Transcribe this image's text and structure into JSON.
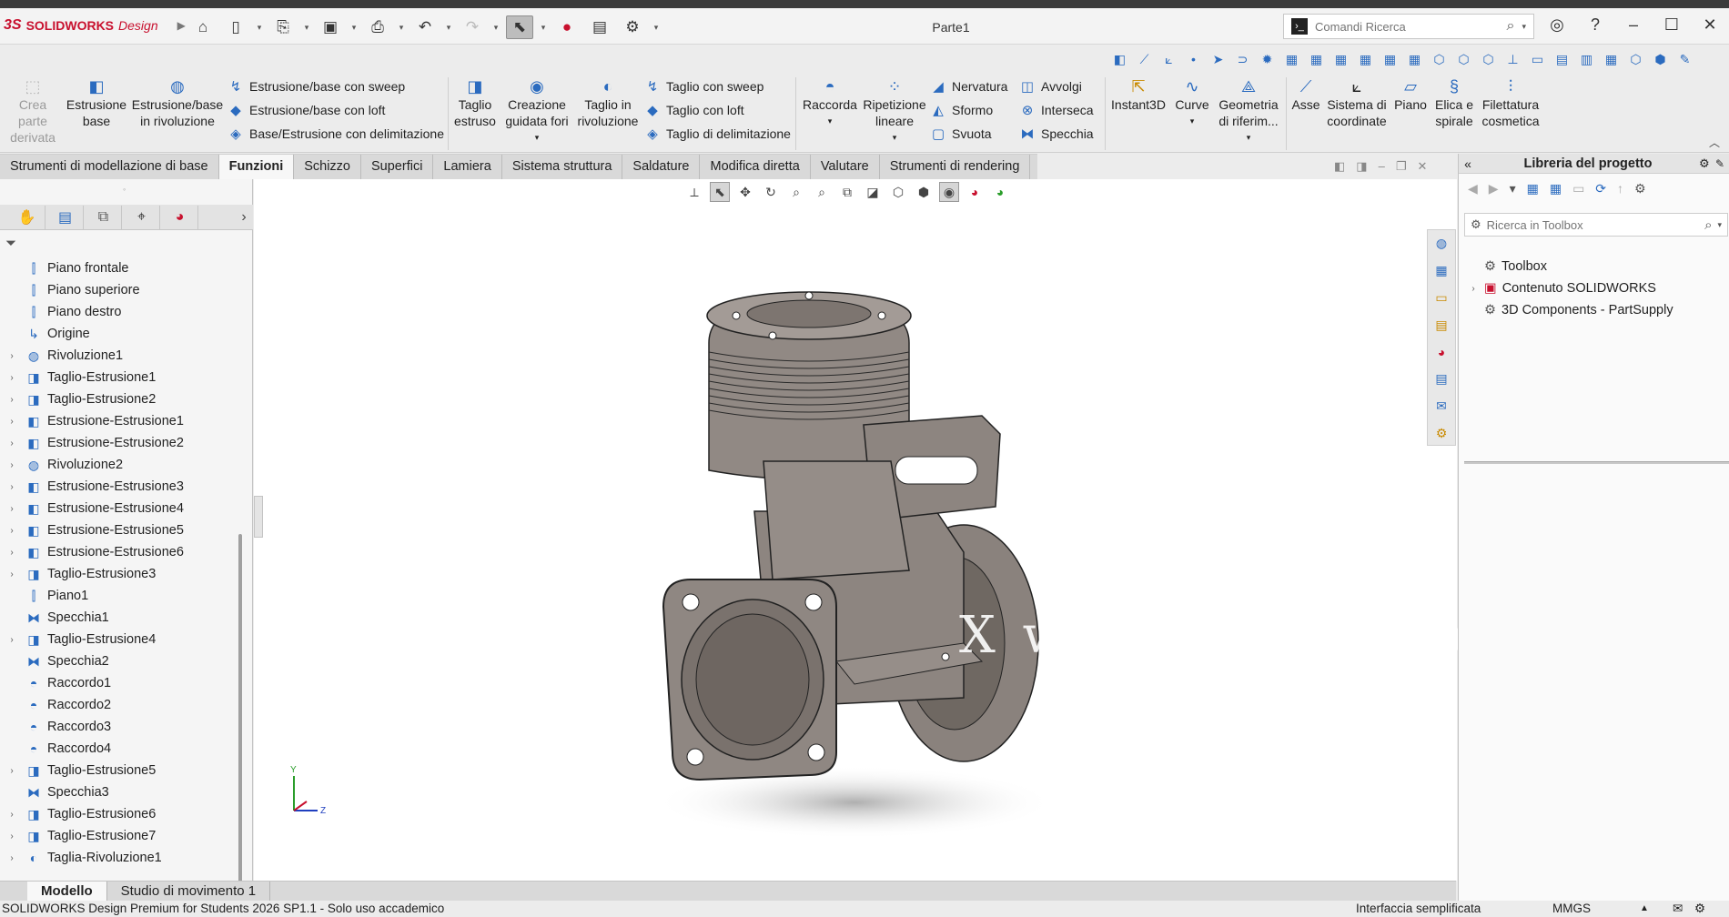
{
  "app": {
    "brand_ds": "3S",
    "brand_sw": "SOLIDWORKS",
    "brand_design": "Design",
    "doc_title": "Parte1"
  },
  "search": {
    "placeholder": "Comandi Ricerca"
  },
  "quick_access": [
    "home-icon",
    "new-icon",
    "open-icon",
    "save-icon",
    "print-icon",
    "undo-icon",
    "redo-icon",
    "select-icon",
    "rebuild-icon",
    "file-props-icon",
    "options-icon"
  ],
  "ribbon": {
    "crea_parte": "Crea\nparte\nderivata",
    "estrusione_base": "Estrusione\nbase",
    "rivoluzione_base": "Estrusione/base\nin rivoluzione",
    "sweep": "Estrusione/base con sweep",
    "loft": "Estrusione/base con loft",
    "delim": "Base/Estrusione con delimitazione",
    "taglio_estruso": "Taglio\nestruso",
    "guidata_fori": "Creazione\nguidata fori",
    "taglio_rivoluzione": "Taglio in\nrivoluzione",
    "taglio_sweep": "Taglio con sweep",
    "taglio_loft": "Taglio con loft",
    "taglio_delim": "Taglio di delimitazione",
    "raccorda": "Raccorda",
    "ripetizione": "Ripetizione\nlineare",
    "nervatura": "Nervatura",
    "sformo": "Sformo",
    "svuota": "Svuota",
    "avvolgi": "Avvolgi",
    "interseca": "Interseca",
    "specchia": "Specchia",
    "instant3d": "Instant3D",
    "curve": "Curve",
    "geometria": "Geometria\ndi riferim...",
    "asse": "Asse",
    "sistema": "Sistema di\ncoordinate",
    "piano": "Piano",
    "elica": "Elica e\nspirale",
    "filettatura": "Filettatura\ncosmetica"
  },
  "tabs": [
    "Strumenti di modellazione di base",
    "Funzioni",
    "Schizzo",
    "Superfici",
    "Lamiera",
    "Sistema struttura",
    "Saldature",
    "Modifica diretta",
    "Valutare",
    "Strumenti di rendering"
  ],
  "active_tab": "Funzioni",
  "tree": [
    {
      "label": "Piano frontale",
      "icon": "plane-icon",
      "expandable": false
    },
    {
      "label": "Piano superiore",
      "icon": "plane-icon",
      "expandable": false
    },
    {
      "label": "Piano destro",
      "icon": "plane-icon",
      "expandable": false
    },
    {
      "label": "Origine",
      "icon": "origin-icon",
      "expandable": false
    },
    {
      "label": "Rivoluzione1",
      "icon": "revolve-icon",
      "expandable": true
    },
    {
      "label": "Taglio-Estrusione1",
      "icon": "cut-extrude-icon",
      "expandable": true
    },
    {
      "label": "Taglio-Estrusione2",
      "icon": "cut-extrude-icon",
      "expandable": true
    },
    {
      "label": "Estrusione-Estrusione1",
      "icon": "boss-extrude-icon",
      "expandable": true
    },
    {
      "label": "Estrusione-Estrusione2",
      "icon": "boss-extrude-icon",
      "expandable": true
    },
    {
      "label": "Rivoluzione2",
      "icon": "revolve-icon",
      "expandable": true
    },
    {
      "label": "Estrusione-Estrusione3",
      "icon": "boss-extrude-icon",
      "expandable": true
    },
    {
      "label": "Estrusione-Estrusione4",
      "icon": "boss-extrude-icon",
      "expandable": true
    },
    {
      "label": "Estrusione-Estrusione5",
      "icon": "boss-extrude-icon",
      "expandable": true
    },
    {
      "label": "Estrusione-Estrusione6",
      "icon": "boss-extrude-icon",
      "expandable": true
    },
    {
      "label": "Taglio-Estrusione3",
      "icon": "cut-extrude-icon",
      "expandable": true
    },
    {
      "label": "Piano1",
      "icon": "plane-icon",
      "expandable": false
    },
    {
      "label": "Specchia1",
      "icon": "mirror-icon",
      "expandable": false
    },
    {
      "label": "Taglio-Estrusione4",
      "icon": "cut-extrude-icon",
      "expandable": true
    },
    {
      "label": "Specchia2",
      "icon": "mirror-icon",
      "expandable": false
    },
    {
      "label": "Raccordo1",
      "icon": "fillet-icon",
      "expandable": false
    },
    {
      "label": "Raccordo2",
      "icon": "fillet-icon",
      "expandable": false
    },
    {
      "label": "Raccordo3",
      "icon": "fillet-icon",
      "expandable": false
    },
    {
      "label": "Raccordo4",
      "icon": "fillet-icon",
      "expandable": false
    },
    {
      "label": "Taglio-Estrusione5",
      "icon": "cut-extrude-icon",
      "expandable": true
    },
    {
      "label": "Specchia3",
      "icon": "mirror-icon",
      "expandable": false
    },
    {
      "label": "Taglio-Estrusione6",
      "icon": "cut-extrude-icon",
      "expandable": true
    },
    {
      "label": "Taglio-Estrusione7",
      "icon": "cut-extrude-icon",
      "expandable": true
    },
    {
      "label": "Taglia-Rivoluzione1",
      "icon": "cut-revolve-icon",
      "expandable": true
    }
  ],
  "bottom_tabs": [
    "Modello",
    "Studio di movimento 1"
  ],
  "status": {
    "left": "SOLIDWORKS Design Premium for Students 2026 SP1.1 - Solo uso accademico",
    "mid": "Interfaccia semplificata",
    "units": "MMGS"
  },
  "right_panel": {
    "title": "Libreria del progetto",
    "search_placeholder": "Ricerca in Toolbox",
    "items": [
      {
        "label": "Toolbox",
        "expandable": false,
        "icon": "toolbox-icon"
      },
      {
        "label": "Contenuto SOLIDWORKS",
        "expandable": true,
        "icon": "sw-content-icon"
      },
      {
        "label": "3D Components - PartSupply",
        "expandable": false,
        "icon": "partsupply-icon"
      }
    ]
  },
  "triad": {
    "y": "Y",
    "z": "Z"
  },
  "watermark": "X www. 3dmox. c",
  "colors": {
    "accent": "#2b6bbf",
    "brand": "#c8102e",
    "model": "#8f8782"
  }
}
